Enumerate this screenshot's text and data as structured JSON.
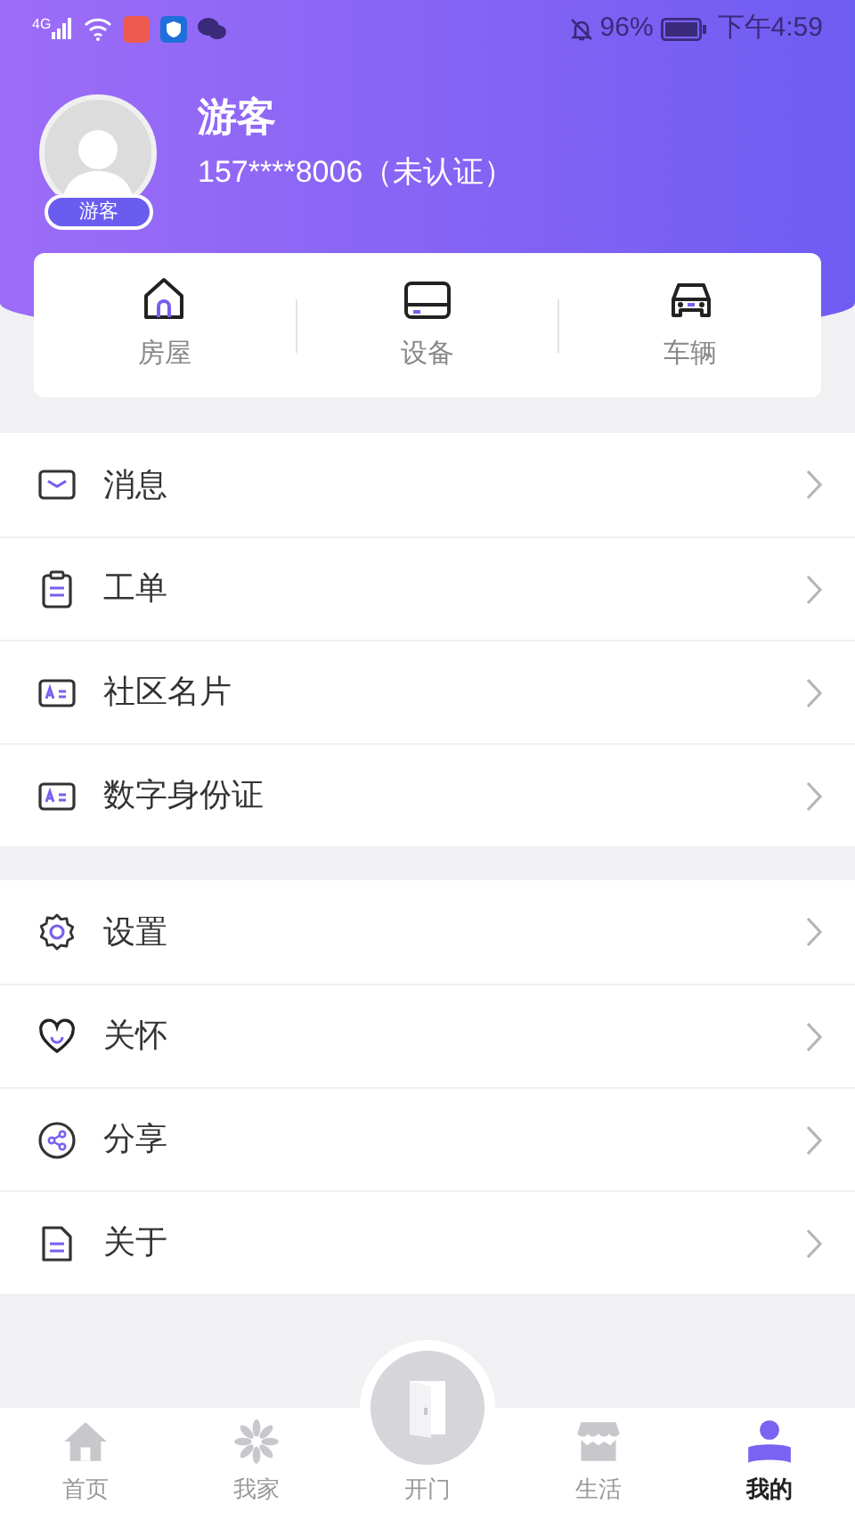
{
  "status_bar": {
    "network": "4G",
    "battery_percent": "96%",
    "time": "下午4:59"
  },
  "profile": {
    "name": "游客",
    "badge": "游客",
    "phone": "157****8006（未认证）"
  },
  "quick_links": [
    {
      "label": "房屋"
    },
    {
      "label": "设备"
    },
    {
      "label": "车辆"
    }
  ],
  "menu_groups": [
    [
      {
        "label": "消息"
      },
      {
        "label": "工单"
      },
      {
        "label": "社区名片"
      },
      {
        "label": "数字身份证"
      }
    ],
    [
      {
        "label": "设置"
      },
      {
        "label": "关怀"
      },
      {
        "label": "分享"
      },
      {
        "label": "关于"
      }
    ]
  ],
  "bottom_nav": [
    {
      "label": "首页",
      "selected": false
    },
    {
      "label": "我家",
      "selected": false
    },
    {
      "label": "开门",
      "selected": false,
      "kind": "center"
    },
    {
      "label": "生活",
      "selected": false
    },
    {
      "label": "我的",
      "selected": true
    }
  ]
}
